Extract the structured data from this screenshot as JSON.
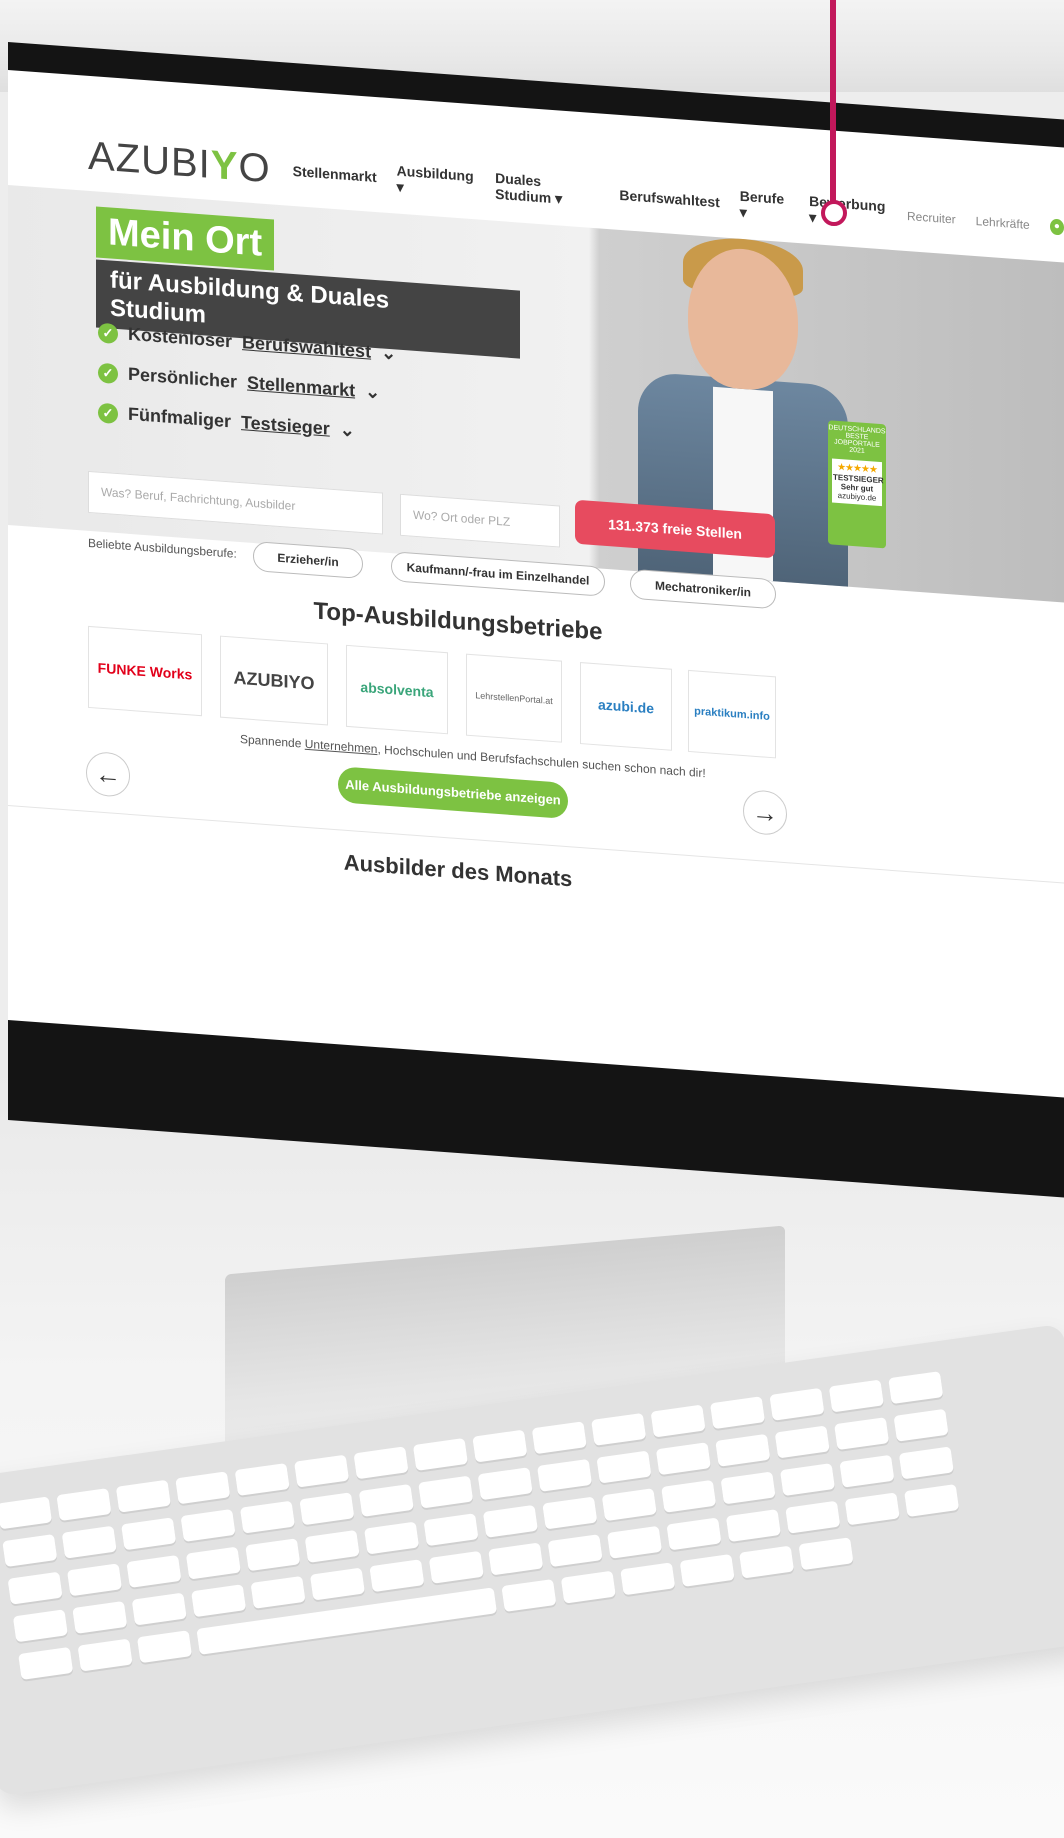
{
  "brand": {
    "logo_pre": "AZUBI",
    "logo_y": "Y",
    "logo_post": "O",
    "accent": "#7dc242",
    "cta": "#e74b5f"
  },
  "nav": {
    "items": [
      {
        "label": "Stellenmarkt",
        "dropdown": false
      },
      {
        "label": "Ausbildung",
        "dropdown": true
      },
      {
        "label": "Duales Studium",
        "dropdown": true
      },
      {
        "label": "Berufswahltest",
        "dropdown": false
      },
      {
        "label": "Berufe",
        "dropdown": true
      },
      {
        "label": "Bewerbung",
        "dropdown": true
      }
    ],
    "recruiter": "Recruiter",
    "teachers": "Lehrkräfte",
    "user_icon": "user-icon"
  },
  "hero": {
    "headline": "Mein Ort",
    "subheadline": "für Ausbildung & Duales Studium",
    "usps": [
      {
        "prefix": "Kostenloser",
        "link": "Berufswahltest"
      },
      {
        "prefix": "Persönlicher",
        "link": "Stellenmarkt"
      },
      {
        "prefix": "Fünfmaliger",
        "link": "Testsieger"
      }
    ],
    "badge": {
      "top": "DEUTSCHLANDS BESTE JOBPORTALE 2021",
      "stars": "★★★★★",
      "title": "TESTSIEGER",
      "rating": "Sehr gut",
      "site": "azubiyo.de"
    }
  },
  "search": {
    "what_placeholder": "Was? Beruf, Fachrichtung, Ausbilder",
    "where_placeholder": "Wo? Ort oder PLZ",
    "button": "131.373 freie Stellen"
  },
  "popular": {
    "label": "Beliebte Ausbildungsberufe:",
    "items": [
      "Erzieher/in",
      "Kaufmann/-frau im Einzelhandel",
      "Mechatroniker/in"
    ]
  },
  "companies": {
    "title": "Top-Ausbildungsbetriebe",
    "logos": [
      "FUNKE Works",
      "AZUBIYO",
      "absolventa",
      "LehrstellenPortal.at",
      "azubi.de",
      "praktikum.info"
    ],
    "subtext_pre": "Spannende ",
    "subtext_link": "Unternehmen",
    "subtext_post": ", Hochschulen und Berufsfachschulen suchen schon nach dir!",
    "all_button": "Alle Ausbildungsbetriebe anzeigen",
    "prev_icon": "arrow-left-icon",
    "next_icon": "arrow-right-icon"
  },
  "month": {
    "title": "Ausbilder des Monats"
  }
}
